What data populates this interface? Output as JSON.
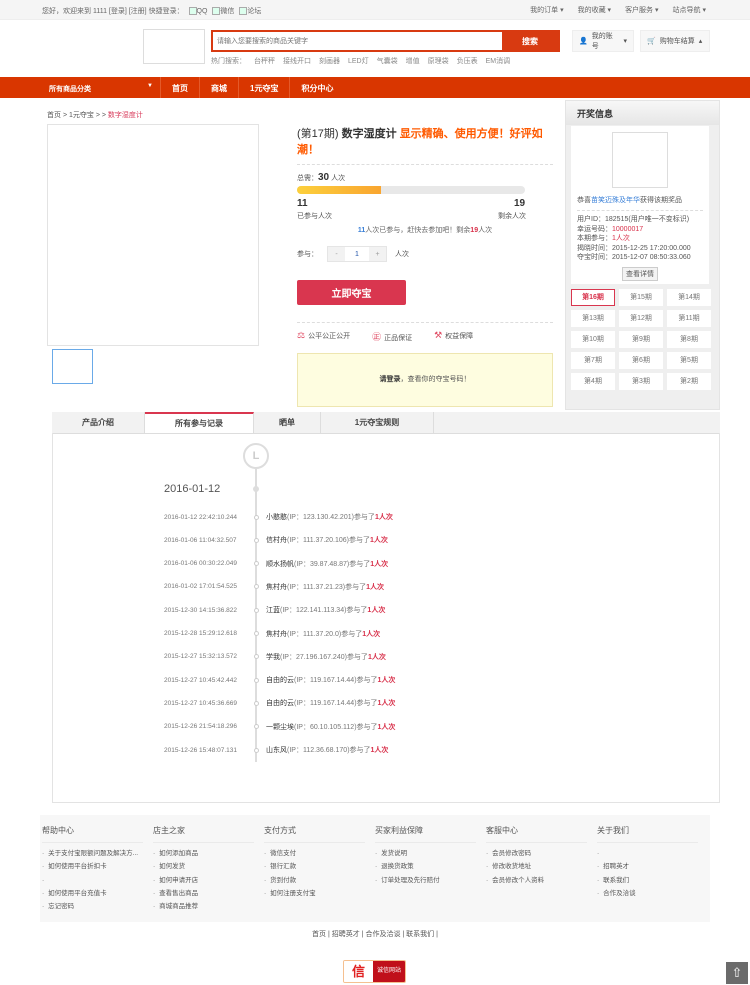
{
  "topbar": {
    "welcome": "您好，欢迎来到 1111 [登录] [注册] 快捷登录：",
    "logins": [
      "QQ",
      "微信",
      "论坛"
    ],
    "links": [
      "我的订单 ▾",
      "我的收藏 ▾",
      "客户服务 ▾",
      "站点导航 ▾"
    ]
  },
  "search": {
    "placeholder": "请输入您要搜索的商品关键字",
    "button": "搜索",
    "hot_label": "热门搜索：",
    "hot": [
      "台秤秤",
      "接线开口",
      "刻画器",
      "LED灯",
      "气囊袋",
      "增值",
      "原理袋",
      "负压表",
      "EM消调"
    ]
  },
  "header": {
    "account": "我的账号",
    "cart": "购物车结算"
  },
  "nav": {
    "category": "所有商品分类",
    "items": [
      "首页",
      "商城",
      "1元夺宝",
      "积分中心"
    ]
  },
  "breadcrumb": [
    "首页",
    "1元夺宝",
    "数字湿度计"
  ],
  "product": {
    "period": "(第17期)",
    "name": "数字湿度计",
    "highlight": "显示精确、使用方便！好评如潮！",
    "total_label": "总需：",
    "total": "30",
    "unit": "人次",
    "progress_percent": 36.7,
    "joined": "11",
    "joined_label": "已参与人次",
    "remaining": "19",
    "remaining_label": "剩余人次",
    "msg_pre": "人次已参与，赶快去参加吧！剩余",
    "msg_post": "人次",
    "qty_label": "参与：",
    "qty": "1",
    "minus": "-",
    "plus": "+",
    "buy": "立即夺宝",
    "guarantees": [
      "公平公正公开",
      "正品保证",
      "权益保障"
    ],
    "guarantee_icons": [
      "⚖",
      "㊣",
      "⚒"
    ],
    "note_bold": "请登录",
    "note": "，查看你的夺宝号码！"
  },
  "draw": {
    "title": "开奖信息",
    "winner_pre": "恭喜",
    "winner": "苗笑迈殊及年华",
    "winner_post": "获得该期奖品",
    "rows": [
      {
        "k": "用户ID：",
        "v": "182515(用户唯一不变标识)"
      },
      {
        "k": "幸运号码：",
        "v": "10000017",
        "red": true
      },
      {
        "k": "本期参与：",
        "v": "1人次",
        "red": true
      },
      {
        "k": "揭晓时间：",
        "v": "2015-12-25 17:20:00.000"
      },
      {
        "k": "夺宝时间：",
        "v": "2015-12-07 08:50:33.060"
      }
    ],
    "detail_button": "查看详情",
    "periods": [
      "第16期",
      "第15期",
      "第14期",
      "第13期",
      "第12期",
      "第11期",
      "第10期",
      "第9期",
      "第8期",
      "第7期",
      "第6期",
      "第5期",
      "第4期",
      "第3期",
      "第2期"
    ]
  },
  "tabs": [
    "产品介绍",
    "所有参与记录",
    "晒单",
    "1元夺宝规则"
  ],
  "records": {
    "date": "2016-01-12",
    "joined_text": "参与了",
    "count_text": "1人次",
    "items": [
      {
        "time": "2016-01-12 22:42:10.244",
        "user": "小憨憨",
        "ip": "(IP：123.130.42.201)"
      },
      {
        "time": "2016-01-06 11:04:32.507",
        "user": "信村舟",
        "ip": "(IP：111.37.20.106)"
      },
      {
        "time": "2016-01-06 00:30:22.049",
        "user": "顺水扬帆",
        "ip": "(IP：39.87.48.87)"
      },
      {
        "time": "2016-01-02 17:01:54.525",
        "user": "焦村舟",
        "ip": "(IP：111.37.21.23)"
      },
      {
        "time": "2015-12-30 14:15:36.822",
        "user": "江蓝",
        "ip": "(IP：122.141.113.34)"
      },
      {
        "time": "2015-12-28 15:29:12.618",
        "user": "焦村舟",
        "ip": "(IP：111.37.20.0)"
      },
      {
        "time": "2015-12-27 15:32:13.572",
        "user": "学我",
        "ip": "(IP：27.196.167.240)"
      },
      {
        "time": "2015-12-27 10:45:42.442",
        "user": "自由的云",
        "ip": "(IP：119.167.14.44)"
      },
      {
        "time": "2015-12-27 10:45:36.669",
        "user": "自由的云",
        "ip": "(IP：119.167.14.44)"
      },
      {
        "time": "2015-12-26 21:54:18.296",
        "user": "一颗尘埃",
        "ip": "(IP：60.10.105.112)"
      },
      {
        "time": "2015-12-26 15:48:07.131",
        "user": "山东风",
        "ip": "(IP：112.36.68.170)"
      }
    ]
  },
  "footer": {
    "cols": [
      {
        "title": "帮助中心",
        "items": [
          "关于支付宝限额问题及解决方...",
          "如何使用平台折扣卡",
          "",
          "如何使用平台充值卡",
          "忘记密码"
        ]
      },
      {
        "title": "店主之家",
        "items": [
          "如何添加商品",
          "如何发货",
          "如何申请开店",
          "查看售出商品",
          "商城商品推荐"
        ]
      },
      {
        "title": "支付方式",
        "items": [
          "微信支付",
          "银行汇款",
          "货到付款",
          "如何注册支付宝"
        ]
      },
      {
        "title": "买家利益保障",
        "items": [
          "发货说明",
          "退换货政策",
          "订单处理及先行赔付"
        ]
      },
      {
        "title": "客服中心",
        "items": [
          "会员修改密码",
          "修改收货地址",
          "会员修改个人资料"
        ]
      },
      {
        "title": "关于我们",
        "items": [
          "",
          "招聘英才",
          "联系我们",
          "合作及洽谈"
        ]
      }
    ],
    "links": "首页 | 招聘英才 | 合作及洽谈 | 联系我们 |",
    "badge_icon": "信",
    "badge": "诚信网站",
    "totop": "⇧"
  },
  "colors": {
    "brand": "#d93600",
    "accent": "#d9364f"
  }
}
